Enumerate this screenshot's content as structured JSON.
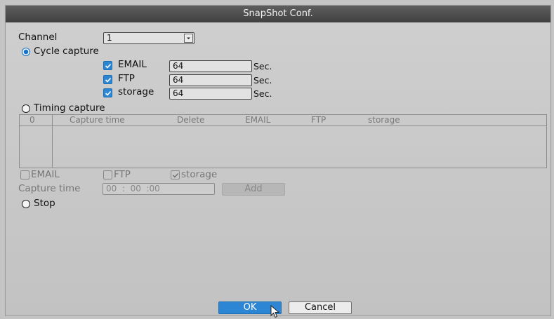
{
  "dialog": {
    "title": "SnapShot Conf."
  },
  "channel": {
    "label": "Channel",
    "value": "1"
  },
  "cycle_capture": {
    "label": "Cycle capture",
    "selected": true,
    "rows": [
      {
        "label": "EMAIL",
        "checked": true,
        "value": "64",
        "unit": "Sec."
      },
      {
        "label": "FTP",
        "checked": true,
        "value": "64",
        "unit": "Sec."
      },
      {
        "label": "storage",
        "checked": true,
        "value": "64",
        "unit": "Sec."
      }
    ]
  },
  "timing_capture": {
    "label": "Timing capture",
    "selected": false,
    "table": {
      "columns": [
        "0",
        "Capture time",
        "Delete",
        "EMAIL",
        "FTP",
        "storage"
      ]
    },
    "options": [
      {
        "label": "EMAIL",
        "checked": false
      },
      {
        "label": "FTP",
        "checked": false
      },
      {
        "label": "storage",
        "checked": true
      }
    ],
    "capture_time_label": "Capture time",
    "capture_time_value": "00  :  00  :00",
    "add_label": "Add"
  },
  "stop": {
    "label": "Stop",
    "selected": false
  },
  "buttons": {
    "ok": "OK",
    "cancel": "Cancel"
  },
  "colors": {
    "accent": "#2d86d4",
    "titlebar": "#4a4a4a",
    "background": "#c8c8c8"
  },
  "icons": {
    "check": "check-icon",
    "dropdown": "chevron-down-icon",
    "cursor": "mouse-pointer-icon"
  }
}
